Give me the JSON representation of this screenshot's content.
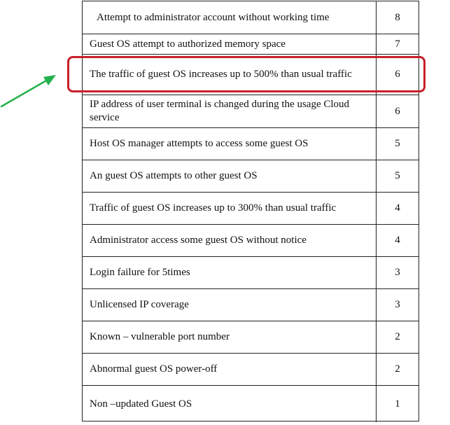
{
  "table": {
    "rows": [
      {
        "description": "Attempt to administrator account without working time",
        "score": "8"
      },
      {
        "description": "Guest OS attempt to authorized memory space",
        "score": "7"
      },
      {
        "description": "The traffic of guest OS increases up to 500% than usual traffic",
        "score": "6"
      },
      {
        "description": "IP address of user terminal is changed during the usage Cloud service",
        "score": "6"
      },
      {
        "description": "Host OS manager attempts to access some guest OS",
        "score": "5"
      },
      {
        "description": "An guest OS attempts to other guest OS",
        "score": "5"
      },
      {
        "description": "Traffic of guest OS increases up to 300% than usual traffic",
        "score": "4"
      },
      {
        "description": "Administrator access some guest OS without notice",
        "score": "4"
      },
      {
        "description": "Login failure for 5times",
        "score": "3"
      },
      {
        "description": "Unlicensed  IP coverage",
        "score": "3"
      },
      {
        "description": "Known – vulnerable port number",
        "score": "2"
      },
      {
        "description": "Abnormal guest OS power-off",
        "score": "2"
      },
      {
        "description": "Non –updated Guest OS",
        "score": "1"
      }
    ]
  },
  "annotation": {
    "highlight_color": "#c8202a",
    "arrow_color": "#22b14c",
    "highlighted_row_index": 2
  }
}
